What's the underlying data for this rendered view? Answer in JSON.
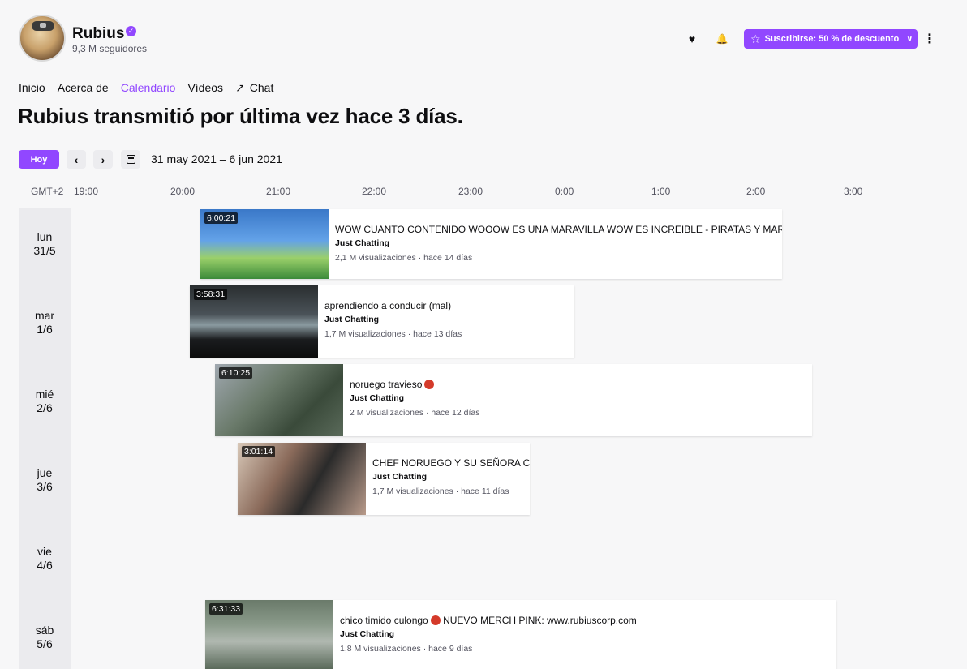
{
  "channel": {
    "name": "Rubius",
    "followers": "9,3 M seguidores",
    "verified_glyph": "✓"
  },
  "header_actions": {
    "heart_icon": "♥",
    "bell_icon": "🔔",
    "subscribe_label": "Suscribirse: 50 % de descuento",
    "more_icon": "⋮"
  },
  "nav": {
    "items": [
      "Inicio",
      "Acerca de",
      "Calendario",
      "Vídeos"
    ],
    "chat_arrow": "↗",
    "chat_label": "Chat",
    "active": "Calendario"
  },
  "headline": "Rubius transmitió por última vez hace 3 días.",
  "toolbar": {
    "today_label": "Hoy",
    "prev_glyph": "‹",
    "next_glyph": "›",
    "date_range": "31 may 2021 – 6 jun 2021"
  },
  "timeline": {
    "timezone": "GMT+2",
    "ticks": [
      "19:00",
      "20:00",
      "21:00",
      "22:00",
      "23:00",
      "0:00",
      "1:00",
      "2:00",
      "3:00"
    ]
  },
  "days": [
    {
      "weekday": "lun",
      "date": "31/5"
    },
    {
      "weekday": "mar",
      "date": "1/6"
    },
    {
      "weekday": "mié",
      "date": "2/6"
    },
    {
      "weekday": "jue",
      "date": "3/6"
    },
    {
      "weekday": "vie",
      "date": "4/6"
    },
    {
      "weekday": "sáb",
      "date": "5/6"
    }
  ],
  "streams": [
    {
      "duration": "6:00:21",
      "title": "WOW CUANTO CONTENIDO WOOOW ES UNA MARAVILLA WOW ES INCREIBLE - PIRATAS Y MARBELL",
      "category": "Just Chatting",
      "meta": "2,1 M visualizaciones · hace 14 días"
    },
    {
      "duration": "3:58:31",
      "title": "aprendiendo a conducir (mal)",
      "category": "Just Chatting",
      "meta": "1,7 M visualizaciones · hace 13 días"
    },
    {
      "duration": "6:10:25",
      "title": "noruego travieso",
      "category": "Just Chatting",
      "meta": "2 M visualizaciones · hace 12 días"
    },
    {
      "duration": "3:01:14",
      "title": "CHEF NORUEGO Y SU SEÑORA COC",
      "category": "Just Chatting",
      "meta": "1,7 M visualizaciones · hace 11 días"
    },
    {
      "duration": "6:31:33",
      "title": "chico timido culongo",
      "title_suffix": "NUEVO MERCH PINK: www.rubiuscorp.com",
      "category": "Just Chatting",
      "meta": "1,8 M visualizaciones · hace 9 días"
    }
  ]
}
